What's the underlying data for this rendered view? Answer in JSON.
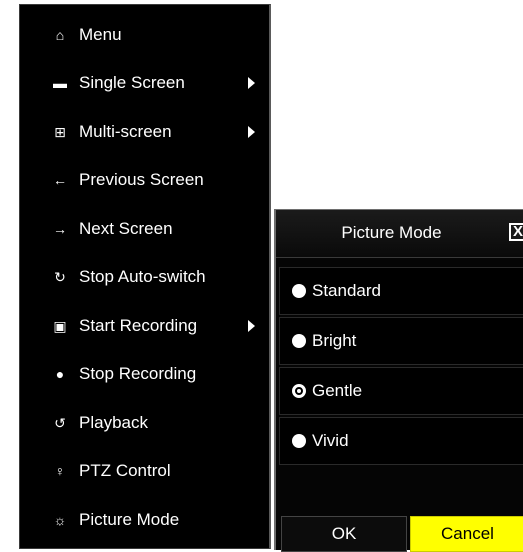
{
  "menu": {
    "items": [
      {
        "label": "Menu",
        "icon": "home-icon",
        "glyph": "⌂",
        "submenu": false
      },
      {
        "label": "Single Screen",
        "icon": "camera-icon",
        "glyph": "▬",
        "submenu": true
      },
      {
        "label": "Multi-screen",
        "icon": "multi-screen-icon",
        "glyph": "⊞",
        "submenu": true
      },
      {
        "label": "Previous Screen",
        "icon": "arrow-left-icon",
        "glyph": "←",
        "submenu": false
      },
      {
        "label": "Next Screen",
        "icon": "arrow-right-icon",
        "glyph": "→",
        "submenu": false
      },
      {
        "label": "Stop Auto-switch",
        "icon": "stop-auto-switch-icon",
        "glyph": "↻",
        "submenu": false
      },
      {
        "label": "Start Recording",
        "icon": "record-icon",
        "glyph": "▣",
        "submenu": true
      },
      {
        "label": "Stop Recording",
        "icon": "stop-record-icon",
        "glyph": "●",
        "submenu": false
      },
      {
        "label": "Playback",
        "icon": "playback-icon",
        "glyph": "↺",
        "submenu": false
      },
      {
        "label": "PTZ Control",
        "icon": "ptz-icon",
        "glyph": "♀",
        "submenu": false
      },
      {
        "label": "Picture Mode",
        "icon": "picture-mode-icon",
        "glyph": "☼",
        "submenu": false
      }
    ]
  },
  "dialog": {
    "title": "Picture Mode",
    "close_label": "X",
    "options": [
      {
        "label": "Standard",
        "selected": false
      },
      {
        "label": "Bright",
        "selected": false
      },
      {
        "label": "Gentle",
        "selected": true
      },
      {
        "label": "Vivid",
        "selected": false
      }
    ],
    "ok_label": "OK",
    "cancel_label": "Cancel"
  },
  "colors": {
    "menu_bg": "#000000",
    "text": "#ffffff",
    "cancel_bg": "#ffff00"
  }
}
